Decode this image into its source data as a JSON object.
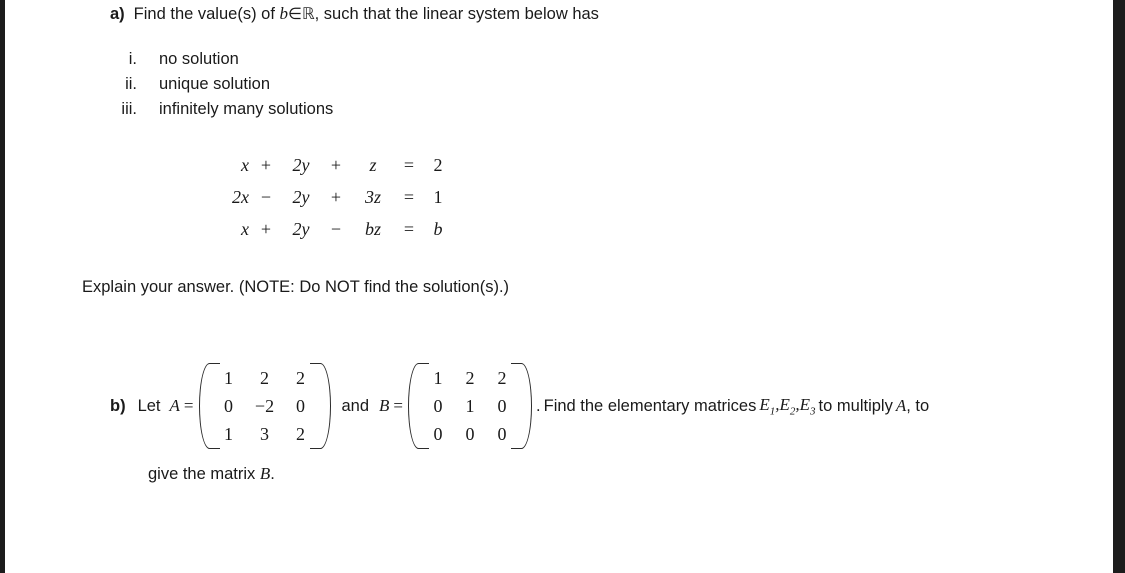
{
  "document": {
    "part_a": {
      "tag": "a)",
      "prompt_pre": "Find the value(s) of",
      "variable": "b",
      "member_symbol": "∈",
      "set_symbol": "ℝ",
      "prompt_post": ", such that the linear system below has",
      "options": [
        {
          "numeral": "i.",
          "text": "no solution"
        },
        {
          "numeral": "ii.",
          "text": "unique solution"
        },
        {
          "numeral": "iii.",
          "text": "infinitely many solutions"
        }
      ],
      "system": {
        "rows": [
          {
            "term1": "x",
            "op1": "+",
            "term2": "2y",
            "op2": "+",
            "term3": "z",
            "equals": "=",
            "rhs": "2"
          },
          {
            "term1": "2x",
            "op1": "−",
            "term2": "2y",
            "op2": "+",
            "term3": "3z",
            "equals": "=",
            "rhs": "1"
          },
          {
            "term1": "x",
            "op1": "+",
            "term2": "2y",
            "op2": "−",
            "term3": "bz",
            "equals": "=",
            "rhs": "b"
          }
        ]
      },
      "explain": "Explain your answer.  (NOTE: Do NOT find the solution(s).)"
    },
    "part_b": {
      "tag": "b)",
      "let_label": "Let",
      "matrix_a_label": "A",
      "equals": "=",
      "matrix_a": [
        [
          "1",
          "2",
          "2"
        ],
        [
          "0",
          "−2",
          "0"
        ],
        [
          "1",
          "3",
          "2"
        ]
      ],
      "conjunction": "and",
      "matrix_b_label": "B",
      "matrix_b": [
        [
          "1",
          "2",
          "2"
        ],
        [
          "0",
          "1",
          "0"
        ],
        [
          "0",
          "0",
          "0"
        ]
      ],
      "period": ".",
      "tail_pre": "Find the elementary matrices",
      "elementary_matrices": [
        "E",
        "E",
        "E"
      ],
      "elementary_subscripts": [
        "1",
        "2",
        "3"
      ],
      "tail_mid": "to multiply",
      "target_matrix": "A",
      "tail_post": ", to",
      "give_pre": "give the matrix",
      "give_matrix": "B",
      "give_post": "."
    }
  },
  "colors": {
    "page_background": "#ffffff",
    "text": "#1a1a1a",
    "edge_band": "#1c1c1c"
  }
}
